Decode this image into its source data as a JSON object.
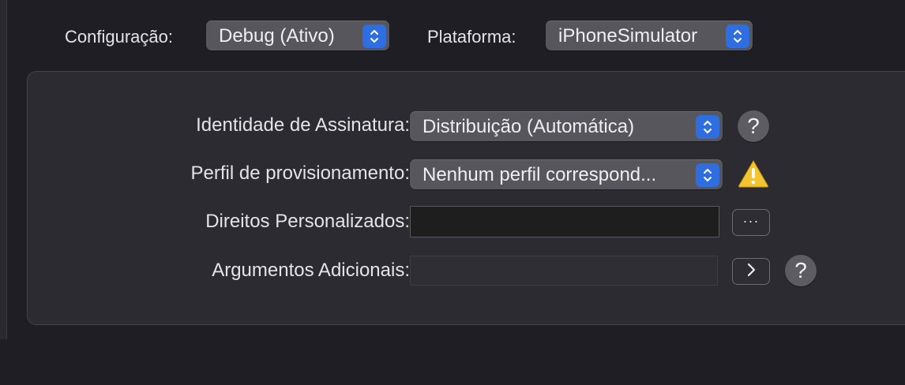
{
  "toolbar": {
    "configuration_label": "Configuração:",
    "configuration_value": "Debug (Ativo)",
    "platform_label": "Plataforma:",
    "platform_value": "iPhoneSimulator"
  },
  "panel": {
    "signing_identity_label": "Identidade de Assinatura:",
    "signing_identity_value": "Distribuição (Automática)",
    "provisioning_profile_label": "Perfil de provisionamento:",
    "provisioning_profile_value": "Nenhum perfil correspond...",
    "custom_entitlements_label": "Direitos Personalizados:",
    "custom_entitlements_value": "",
    "browse_button_label": "···",
    "additional_arguments_label": "Argumentos Adicionais:",
    "additional_arguments_value": "",
    "help_glyph": "?"
  },
  "icons": {
    "stepper": "chevron-updown-icon",
    "help": "question-mark-icon",
    "warning": "warning-triangle-icon",
    "expand": "chevron-right-icon"
  },
  "colors": {
    "background": "#1f1e24",
    "panel": "#2c2b31",
    "popup": "#57565c",
    "accent": "#2f6ee0",
    "warning": "#f4c430"
  }
}
